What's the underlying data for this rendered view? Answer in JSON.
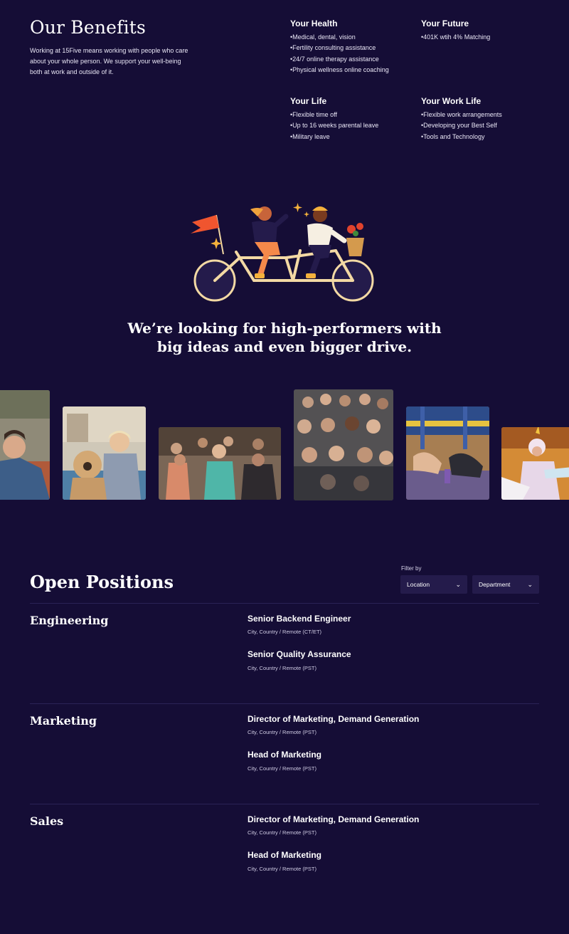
{
  "benefits": {
    "title": "Our Benefits",
    "intro": "Working at 15Five means working with people who care about your whole person. We support your well-being both at work and outside of it.",
    "groups": [
      {
        "title": "Your Health",
        "items": [
          "Medical, dental, vision",
          "Fertility consulting assistance",
          "24/7 online therapy assistance",
          "Physical wellness online coaching"
        ]
      },
      {
        "title": "Your Future",
        "items": [
          "401K wtih 4% Matching"
        ]
      },
      {
        "title": "Your Life",
        "items": [
          "Flexible time off",
          "Up to 16 weeks parental leave",
          "Military leave"
        ]
      },
      {
        "title": "Your Work Life",
        "items": [
          "Flexible work arrangements",
          "Developing your Best Self",
          "Tools and Technology"
        ]
      }
    ]
  },
  "illustration": {
    "icon": "tandem-bicycle-illustration"
  },
  "tagline": {
    "line1": "We’re looking for high-performers with",
    "line2": "big ideas and even bigger drive."
  },
  "photos": [
    {
      "name": "photo-woman-with-dog-outdoors"
    },
    {
      "name": "photo-woman-with-goldendoodle"
    },
    {
      "name": "photo-group-meditation-session"
    },
    {
      "name": "photo-team-group-portrait"
    },
    {
      "name": "photo-yoga-class"
    },
    {
      "name": "photo-person-in-unicorn-costume"
    }
  ],
  "positions": {
    "title": "Open Positions",
    "filter_label": "Filter by",
    "location_label": "Location",
    "department_label": "Department",
    "departments": [
      {
        "name": "Engineering",
        "jobs": [
          {
            "title": "Senior Backend Engineer",
            "location": "City, Country / Remote (CT/ET)"
          },
          {
            "title": "Senior Quality Assurance",
            "location": "City, Country / Remote (PST)"
          }
        ]
      },
      {
        "name": "Marketing",
        "jobs": [
          {
            "title": "Director of Marketing, Demand Generation",
            "location": "City, Country / Remote (PST)"
          },
          {
            "title": "Head of Marketing",
            "location": "City, Country / Remote (PST)"
          }
        ]
      },
      {
        "name": "Sales",
        "jobs": [
          {
            "title": "Director of Marketing, Demand Generation",
            "location": "City, Country / Remote (PST)"
          },
          {
            "title": "Head of Marketing",
            "location": "City, Country / Remote (PST)"
          }
        ]
      }
    ]
  },
  "colors": {
    "background": "#150d36",
    "select_bg": "#241b4b",
    "divider": "#2a2256"
  }
}
